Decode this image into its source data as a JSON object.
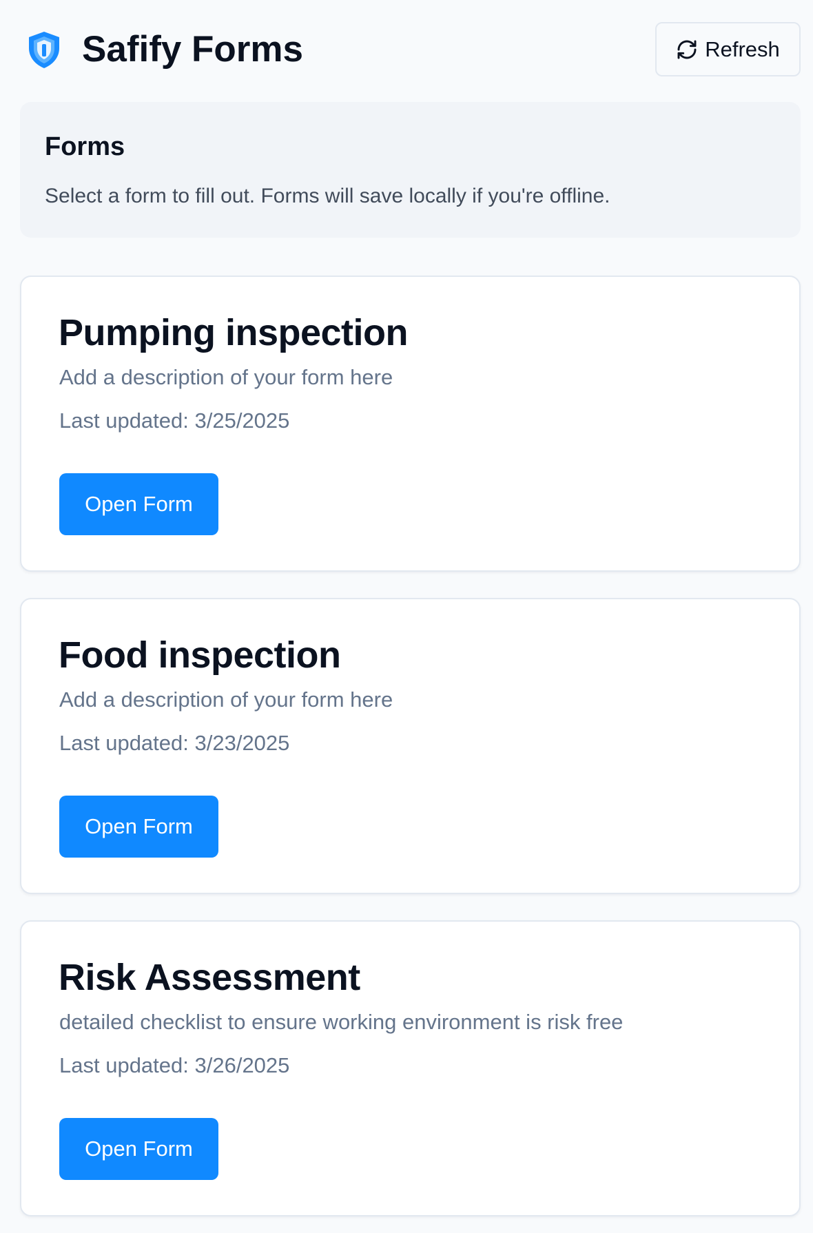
{
  "header": {
    "title": "Safify Forms",
    "logo_icon": "shield-keyhole-icon",
    "refresh_label": "Refresh",
    "refresh_icon": "refresh-icon"
  },
  "info": {
    "title": "Forms",
    "description": "Select a form to fill out. Forms will save locally if you're offline."
  },
  "colors": {
    "accent": "#1089ff",
    "background": "#f8fafc",
    "muted_text": "#64748b"
  },
  "forms": [
    {
      "title": "Pumping inspection",
      "description": "Add a description of your form here",
      "updated": "Last updated: 3/25/2025",
      "button": "Open Form"
    },
    {
      "title": "Food inspection",
      "description": "Add a description of your form here",
      "updated": "Last updated: 3/23/2025",
      "button": "Open Form"
    },
    {
      "title": "Risk Assessment",
      "description": "detailed checklist to ensure working environment is risk free",
      "updated": "Last updated: 3/26/2025",
      "button": "Open Form"
    }
  ]
}
